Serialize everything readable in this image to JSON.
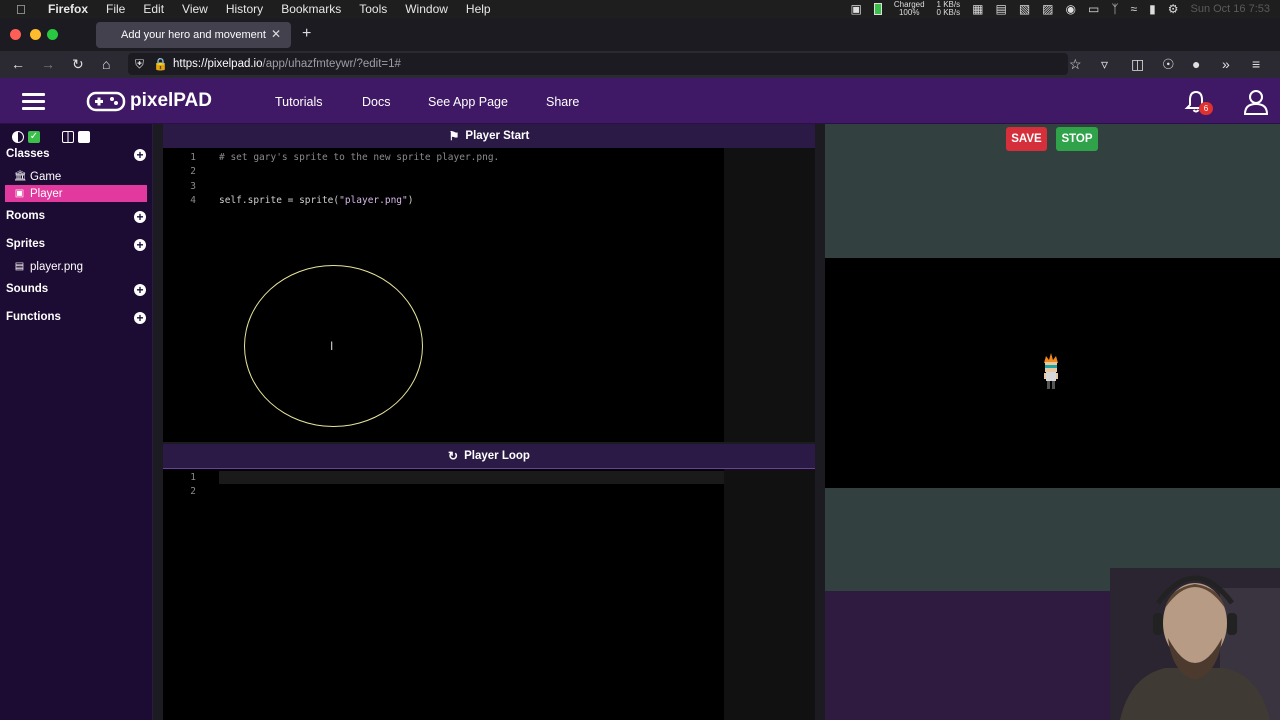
{
  "macos_menu": {
    "app": "Firefox",
    "items": [
      "File",
      "Edit",
      "View",
      "History",
      "Bookmarks",
      "Tools",
      "Window",
      "Help"
    ],
    "battery_label": "Charged",
    "battery_pct": "100%",
    "net_up": "1 KB/s",
    "net_down": "0 KB/s",
    "clock": "Sun Oct 16  7:53"
  },
  "browser": {
    "tab_title": "Add your hero and movement",
    "url_base": "https://pixelpad.io",
    "url_path": "/app/uhazfmteywr/?edit=1#"
  },
  "app": {
    "logo": "pixelPAD",
    "nav": [
      "Tutorials",
      "Docs",
      "See App Page",
      "Share"
    ],
    "notification_count": "6"
  },
  "sidebar": {
    "sections": {
      "classes": "Classes",
      "rooms": "Rooms",
      "sprites": "Sprites",
      "sounds": "Sounds",
      "functions": "Functions"
    },
    "classes": [
      "Game",
      "Player"
    ],
    "sprites": [
      "player.png"
    ]
  },
  "editor": {
    "start_title": "Player Start",
    "loop_title": "Player Loop",
    "start_lines": [
      {
        "n": "1",
        "code": "# set gary's sprite to the new sprite player.png."
      },
      {
        "n": "2",
        "code": ""
      },
      {
        "n": "3",
        "code": ""
      },
      {
        "n": "4",
        "code_pre": "self.sprite = sprite(",
        "code_str": "\"player.png\"",
        "code_post": ")"
      }
    ],
    "loop_lines": [
      "1",
      "2"
    ]
  },
  "game": {
    "save_label": "SAVE",
    "stop_label": "STOP"
  },
  "colors": {
    "header_purple": "#3f1866",
    "active_pink": "#e2399e",
    "save_red": "#d42f3b",
    "stop_green": "#2fa24a"
  }
}
